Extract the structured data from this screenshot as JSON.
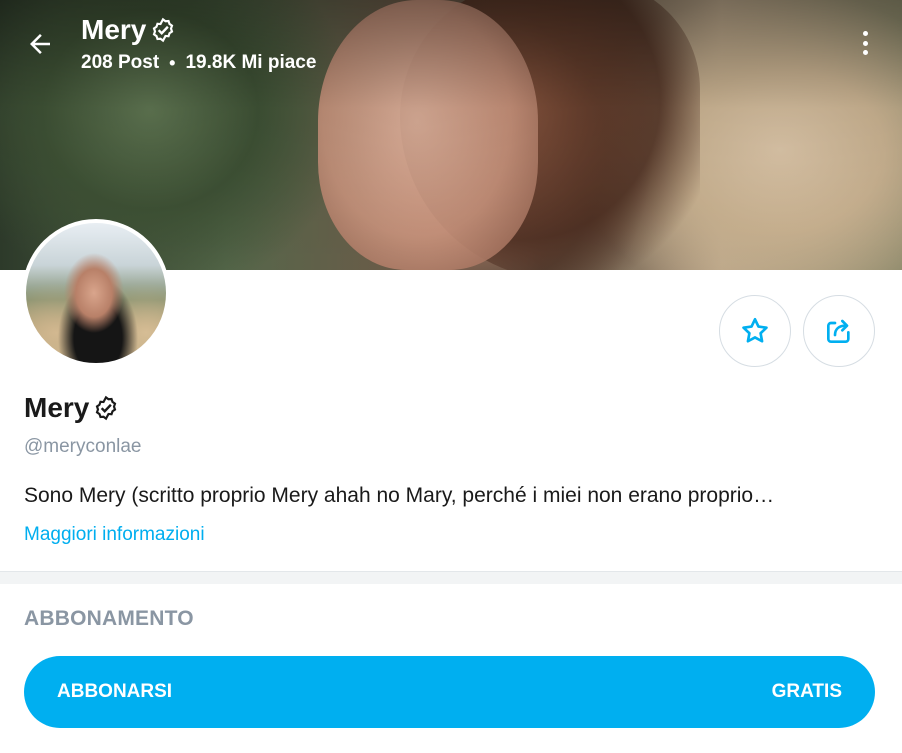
{
  "header": {
    "name": "Mery",
    "posts": "208 Post",
    "likes": "19.8K Mi piace"
  },
  "profile": {
    "name": "Mery",
    "handle": "@meryconlae",
    "bio": "Sono Mery (scritto proprio Mery ahah no Mary, perché i miei non erano proprio…",
    "more_info": "Maggiori informazioni"
  },
  "subscription": {
    "section_title": "ABBONAMENTO",
    "button_label": "ABBONARSI",
    "price_label": "GRATIS"
  },
  "colors": {
    "accent": "#00aff0",
    "muted_text": "#8a96a3",
    "text": "#1a1a1a"
  },
  "icons": {
    "back": "arrow-left-icon",
    "verified": "verified-badge-icon",
    "more": "more-vertical-icon",
    "favorite": "star-icon",
    "share": "share-icon"
  }
}
